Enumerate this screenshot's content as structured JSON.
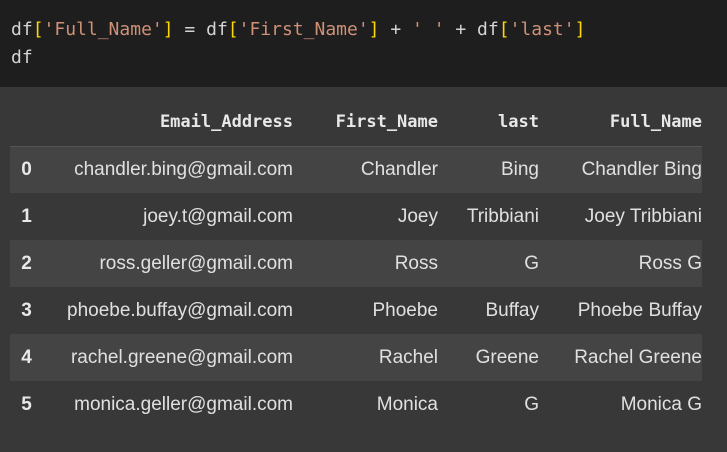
{
  "code": {
    "line1": {
      "p1": "df",
      "b1": "[",
      "s1": "'Full_Name'",
      "b2": "]",
      "p2": " = df",
      "b3": "[",
      "s2": "'First_Name'",
      "b4": "]",
      "p3": " + ",
      "s3": "' '",
      "p4": " + df",
      "b5": "[",
      "s4": "'last'",
      "b6": "]"
    },
    "line2": "df"
  },
  "table": {
    "columns": [
      "",
      "Email_Address",
      "First_Name",
      "last",
      "Full_Name"
    ],
    "rows": [
      {
        "index": "0",
        "email": "chandler.bing@gmail.com",
        "first": "Chandler",
        "last": "Bing",
        "full": "Chandler Bing"
      },
      {
        "index": "1",
        "email": "joey.t@gmail.com",
        "first": "Joey",
        "last": "Tribbiani",
        "full": "Joey Tribbiani"
      },
      {
        "index": "2",
        "email": "ross.geller@gmail.com",
        "first": "Ross",
        "last": "G",
        "full": "Ross G"
      },
      {
        "index": "3",
        "email": "phoebe.buffay@gmail.com",
        "first": "Phoebe",
        "last": "Buffay",
        "full": "Phoebe Buffay"
      },
      {
        "index": "4",
        "email": "rachel.greene@gmail.com",
        "first": "Rachel",
        "last": "Greene",
        "full": "Rachel Greene"
      },
      {
        "index": "5",
        "email": "monica.geller@gmail.com",
        "first": "Monica",
        "last": "G",
        "full": "Monica G"
      }
    ]
  },
  "colors": {
    "code_bg": "#1e1e1e",
    "output_bg": "#383838",
    "row_alt": "#444444",
    "string": "#ce9178",
    "bracket": "#ffd700"
  }
}
